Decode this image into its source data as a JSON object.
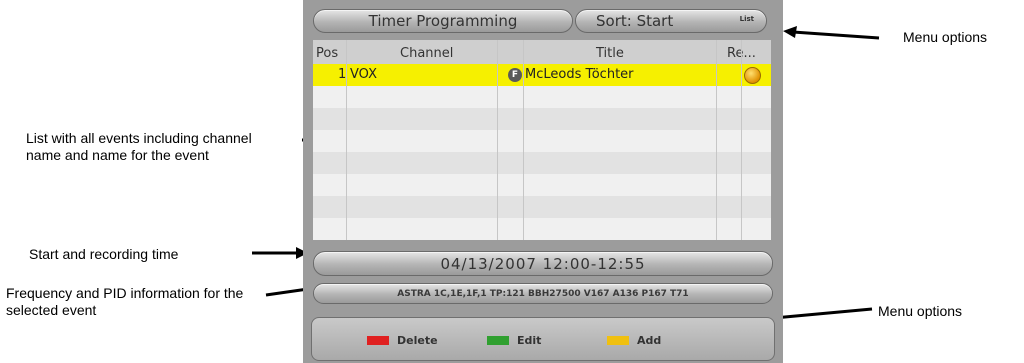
{
  "annotations": {
    "menu_options_top": "Menu options",
    "list_desc": "List with all events including channel name and name for the event",
    "start_time": "Start and recording time",
    "freq_pid": "Frequency and PID information for the selected event",
    "menu_options_bottom": "Menu options"
  },
  "header": {
    "title": "Timer Programming",
    "sort_label": "Sort: Start",
    "list_badge": "List"
  },
  "table": {
    "columns": [
      "Pos",
      "Channel",
      "Title",
      "Re..."
    ],
    "rows": [
      {
        "pos": "1",
        "channel": "VOX",
        "badge": "F",
        "title": "McLeods Töchter",
        "record": "recording-dot-icon"
      }
    ]
  },
  "status": {
    "datetime": "04/13/2007 12:00-12:55",
    "freq_info": "ASTRA 1C,1E,1F,1 TP:121 BBH27500 V167 A136 P167 T71"
  },
  "footer": {
    "delete": "Delete",
    "edit": "Edit",
    "add": "Add"
  },
  "colors": {
    "selected_row": "#f6f000",
    "delete": "#e02020",
    "edit": "#30a030",
    "add": "#f0c010"
  }
}
